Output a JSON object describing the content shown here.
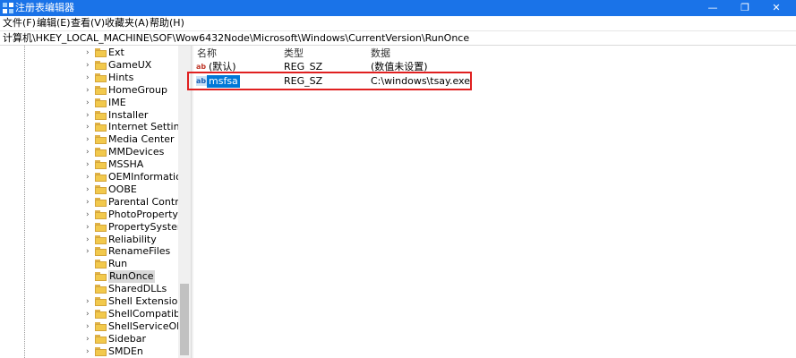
{
  "window": {
    "title": "注册表编辑器",
    "controls": {
      "minimize": "—",
      "maximize": "❐",
      "close": "✕"
    }
  },
  "menu": [
    "文件(F)",
    "编辑(E)",
    "查看(V)",
    "收藏夹(A)",
    "帮助(H)"
  ],
  "address": "计算机\\HKEY_LOCAL_MACHINE\\SOF\\Wow6432Node\\Microsoft\\Windows\\CurrentVersion\\RunOnce",
  "tree": {
    "items": [
      {
        "label": "Ext",
        "expandable": true
      },
      {
        "label": "GameUX",
        "expandable": true
      },
      {
        "label": "Hints",
        "expandable": true
      },
      {
        "label": "HomeGroup",
        "expandable": true
      },
      {
        "label": "IME",
        "expandable": true
      },
      {
        "label": "Installer",
        "expandable": true
      },
      {
        "label": "Internet Settings",
        "expandable": true
      },
      {
        "label": "Media Center",
        "expandable": true
      },
      {
        "label": "MMDevices",
        "expandable": true
      },
      {
        "label": "MSSHA",
        "expandable": true
      },
      {
        "label": "OEMInformation",
        "expandable": true
      },
      {
        "label": "OOBE",
        "expandable": true
      },
      {
        "label": "Parental Controls",
        "expandable": true
      },
      {
        "label": "PhotoPropertyHandler",
        "expandable": true
      },
      {
        "label": "PropertySystem",
        "expandable": true
      },
      {
        "label": "Reliability",
        "expandable": true
      },
      {
        "label": "RenameFiles",
        "expandable": true
      },
      {
        "label": "Run",
        "expandable": false
      },
      {
        "label": "RunOnce",
        "expandable": false,
        "selected": true
      },
      {
        "label": "SharedDLLs",
        "expandable": false
      },
      {
        "label": "Shell Extensions",
        "expandable": true
      },
      {
        "label": "ShellCompatibility",
        "expandable": true
      },
      {
        "label": "ShellServiceObjects",
        "expandable": true
      },
      {
        "label": "Sidebar",
        "expandable": true
      },
      {
        "label": "SMDEn",
        "expandable": true
      }
    ]
  },
  "list": {
    "headers": {
      "name": "名称",
      "type": "类型",
      "data": "数据"
    },
    "rows": [
      {
        "icon": "ab",
        "name": "(默认)",
        "type": "REG_SZ",
        "data": "(数值未设置)"
      },
      {
        "icon": "ab",
        "name": "msfsa",
        "type": "REG_SZ",
        "data": "C:\\windows\\tsay.exe",
        "selected": true
      }
    ]
  },
  "colors": {
    "titlebar": "#1a73e8",
    "selection": "#0078d7",
    "highlight_box": "#e02020",
    "folder": "#f2c94c"
  }
}
